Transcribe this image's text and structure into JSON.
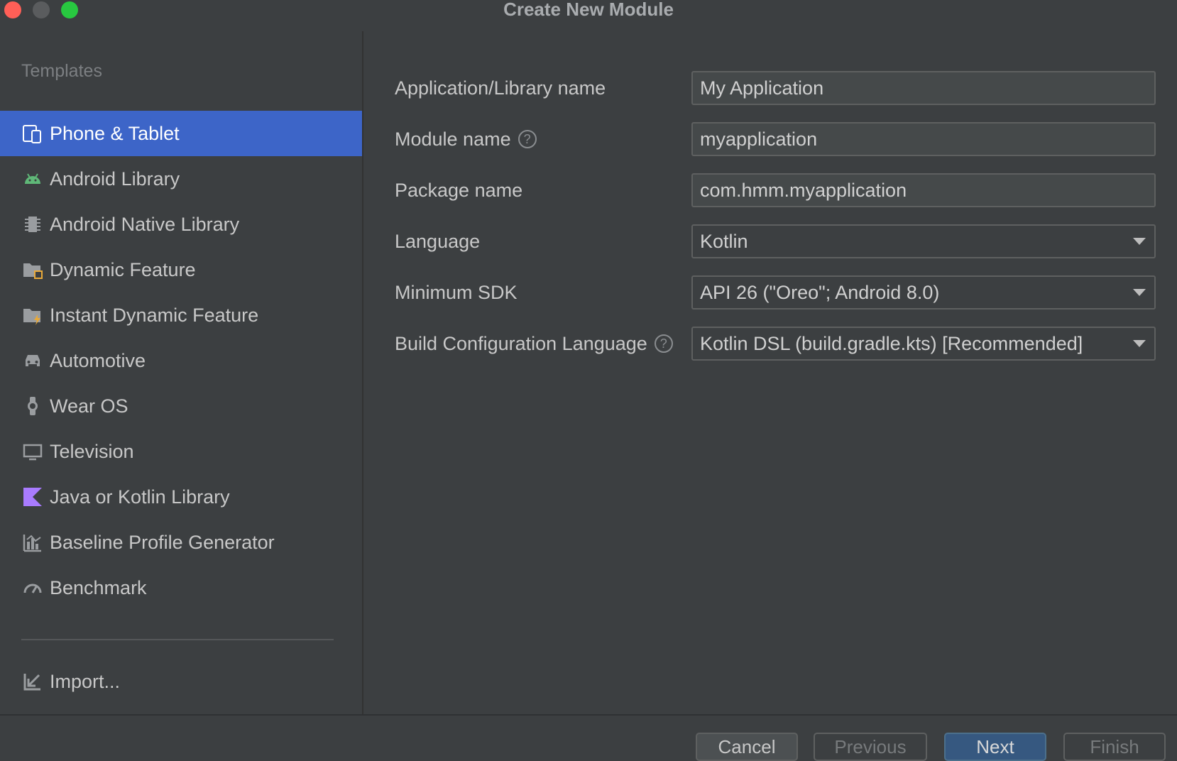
{
  "window": {
    "title": "Create New Module"
  },
  "sidebar": {
    "header": "Templates",
    "items": [
      {
        "label": "Phone & Tablet",
        "icon": "phone-tablet-icon",
        "selected": true
      },
      {
        "label": "Android Library",
        "icon": "android-icon"
      },
      {
        "label": "Android Native Library",
        "icon": "chip-icon"
      },
      {
        "label": "Dynamic Feature",
        "icon": "folder-module-icon"
      },
      {
        "label": "Instant Dynamic Feature",
        "icon": "folder-lightning-icon"
      },
      {
        "label": "Automotive",
        "icon": "car-icon"
      },
      {
        "label": "Wear OS",
        "icon": "watch-icon"
      },
      {
        "label": "Television",
        "icon": "tv-icon"
      },
      {
        "label": "Java or Kotlin Library",
        "icon": "kotlin-icon"
      },
      {
        "label": "Baseline Profile Generator",
        "icon": "chart-icon"
      },
      {
        "label": "Benchmark",
        "icon": "gauge-icon"
      }
    ],
    "import_label": "Import..."
  },
  "form": {
    "app_name": {
      "label": "Application/Library name",
      "value": "My Application"
    },
    "module_name": {
      "label": "Module name",
      "value": "myapplication"
    },
    "package_name": {
      "label": "Package name",
      "value": "com.hmm.myapplication"
    },
    "language": {
      "label": "Language",
      "value": "Kotlin"
    },
    "min_sdk": {
      "label": "Minimum SDK",
      "value": "API 26 (\"Oreo\"; Android 8.0)"
    },
    "build_config": {
      "label": "Build Configuration Language",
      "value": "Kotlin DSL (build.gradle.kts) [Recommended]"
    }
  },
  "footer": {
    "cancel": "Cancel",
    "previous": "Previous",
    "next": "Next",
    "finish": "Finish"
  },
  "colors": {
    "background": "#3c3f41",
    "selection": "#3d65c8",
    "primary_button": "#365880"
  }
}
